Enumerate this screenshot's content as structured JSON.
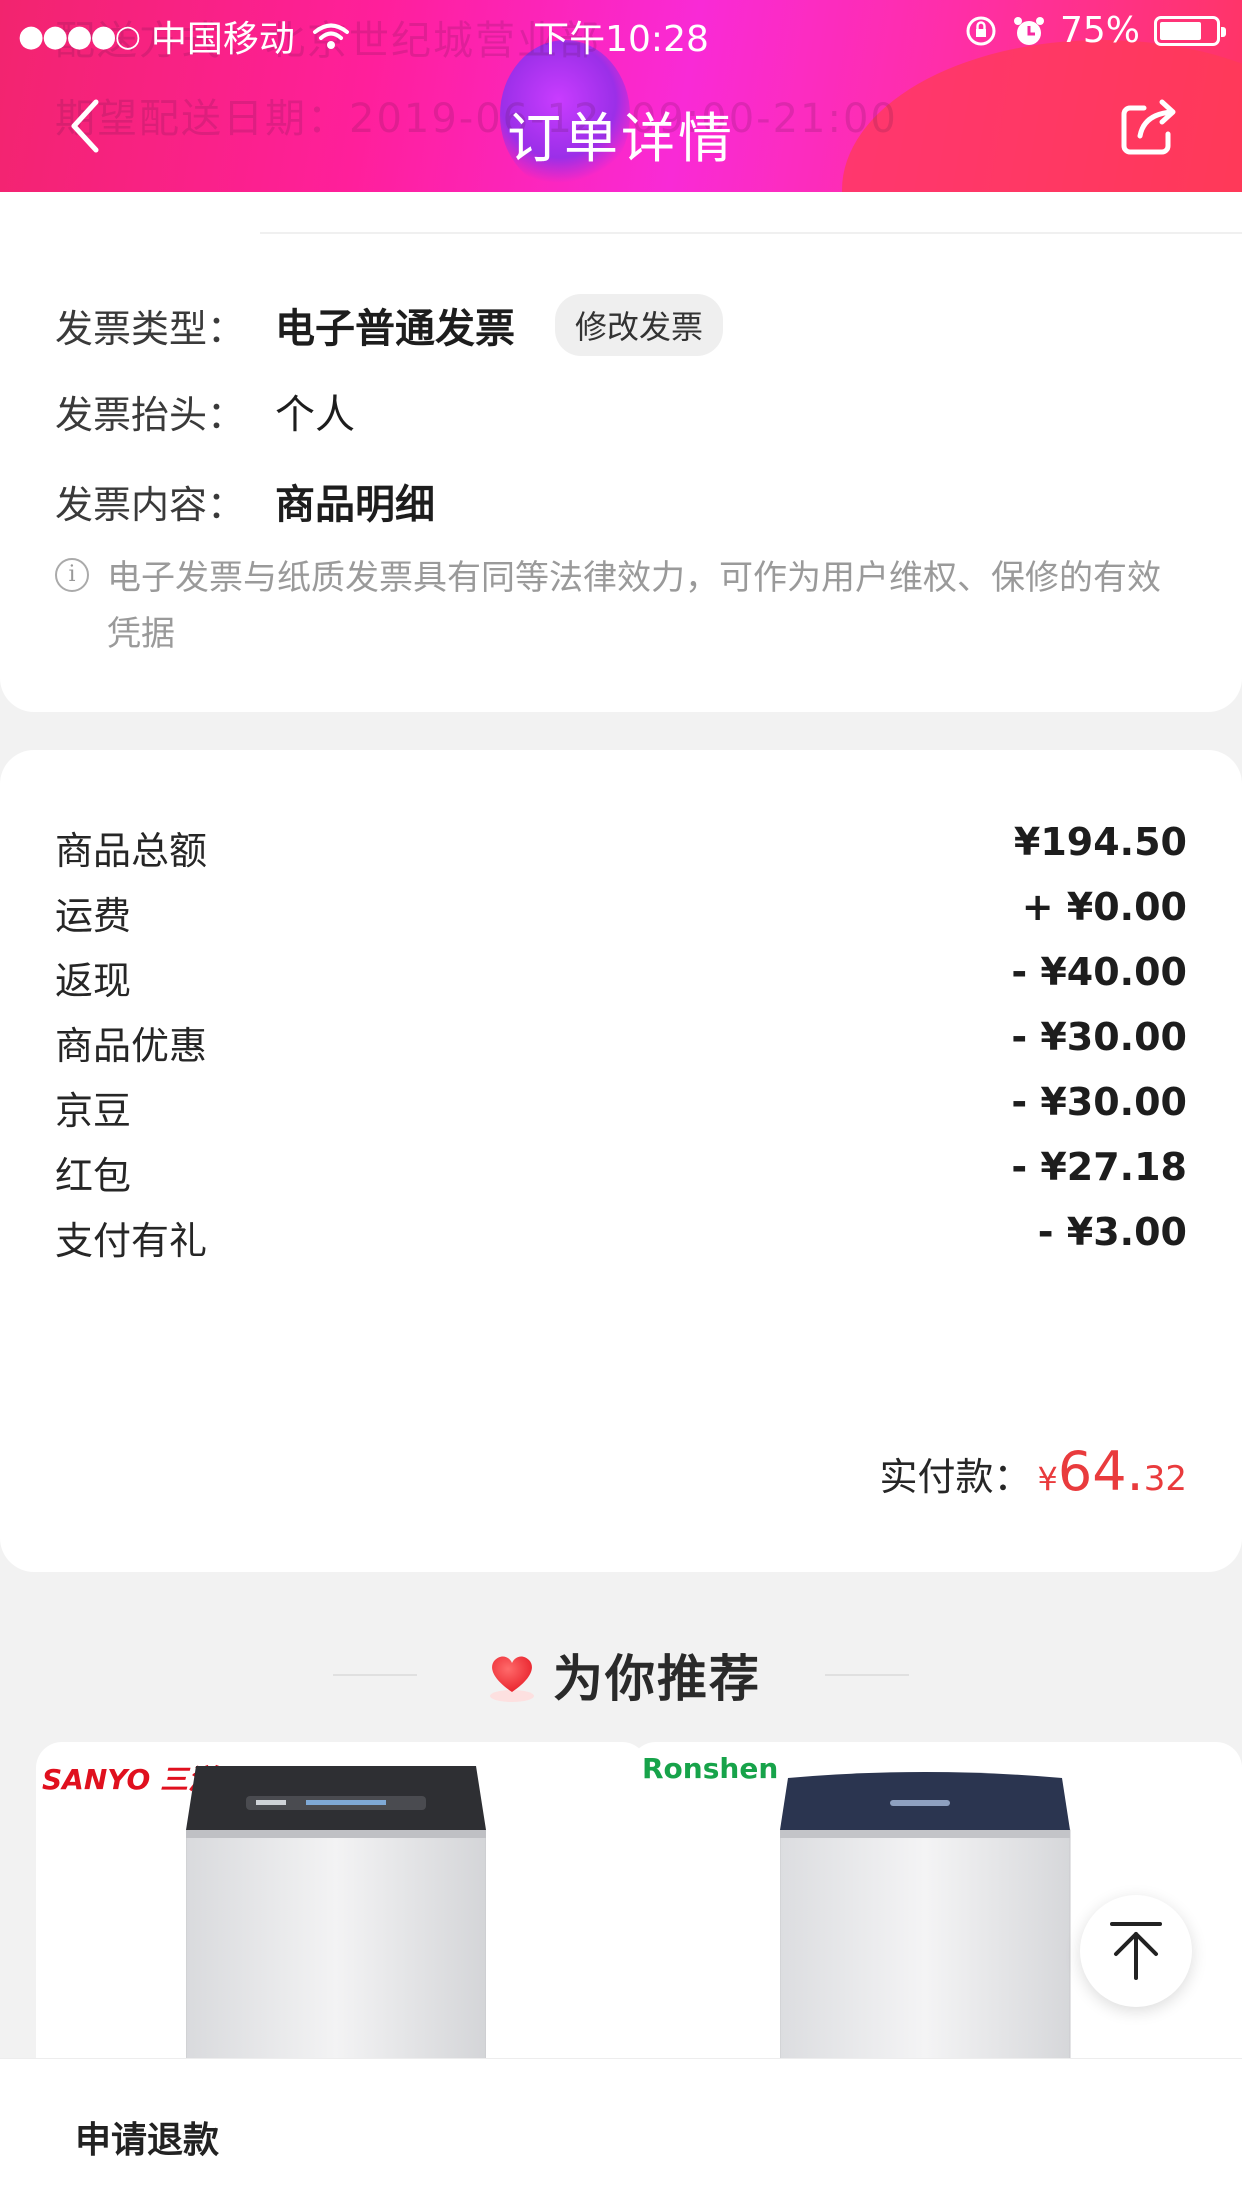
{
  "status_bar": {
    "signal_dots": "●●●●○",
    "carrier": "中国移动",
    "time": "下午10:28",
    "battery": "75%",
    "battery_level": 0.75
  },
  "ghost_text": {
    "line1": "配送方式：北京世纪城营业部",
    "line2": "期望配送日期：2019-06-12, 09:00-21:00"
  },
  "nav": {
    "title": "订单详情",
    "back_icon": "chevron-left-icon",
    "share_icon": "share-icon"
  },
  "invoice": {
    "type_label": "发票类型：",
    "type_value": "电子普通发票",
    "modify_button": "修改发票",
    "header_label": "发票抬头：",
    "header_value": "个人",
    "content_label": "发票内容：",
    "content_value": "商品明细",
    "notice": "电子发票与纸质发票具有同等法律效力，可作为用户维权、保修的有效凭据"
  },
  "price": {
    "rows": [
      {
        "label": "商品总额",
        "amount": "¥194.50"
      },
      {
        "label": "运费",
        "amount": "+ ¥0.00"
      },
      {
        "label": "返现",
        "amount": "- ¥40.00"
      },
      {
        "label": "商品优惠",
        "amount": "- ¥30.00"
      },
      {
        "label": "京豆",
        "amount": "- ¥30.00"
      },
      {
        "label": "红包",
        "amount": "- ¥27.18"
      },
      {
        "label": "支付有礼",
        "amount": "- ¥3.00"
      }
    ],
    "total_label": "实付款：",
    "total_currency": "¥",
    "total_int": "64.",
    "total_dec": "32",
    "accent_color": "#e93b3d"
  },
  "recommend": {
    "title": "为你推荐",
    "products": [
      {
        "brand": "SANYO 三洋"
      },
      {
        "brand": "Ronshen"
      }
    ]
  },
  "bottom": {
    "refund_button": "申请退款"
  },
  "colors": {
    "header_gradient_start": "#f2246e",
    "header_gradient_mid": "#f92ad6",
    "header_gradient_end": "#ff3562"
  }
}
